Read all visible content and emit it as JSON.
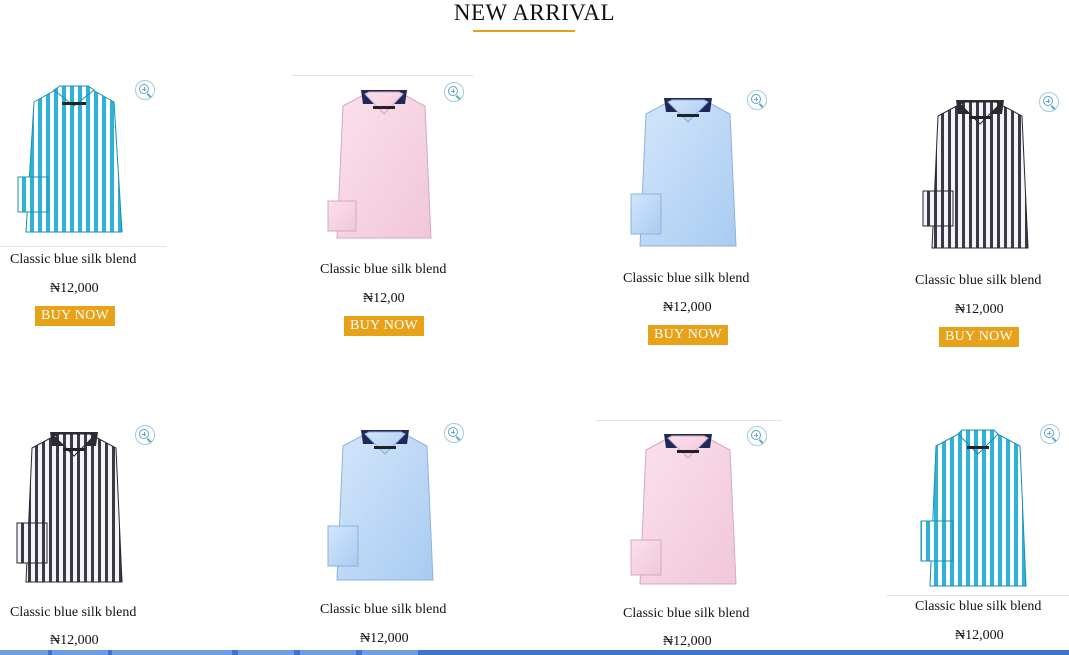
{
  "section": {
    "title": "NEW ARRIVAL",
    "accent_color": "#e8a21a"
  },
  "icons": {
    "zoom": "zoom-in-icon"
  },
  "products": [
    {
      "name": "Classic blue silk blend",
      "price": "₦12,000",
      "button": "BUY NOW",
      "shirt_color": "turquoise-stripe"
    },
    {
      "name": "Classic blue silk blend",
      "price": "₦12,00",
      "button": "BUY NOW",
      "shirt_color": "pink"
    },
    {
      "name": "Classic blue silk blend",
      "price": "₦12,000",
      "button": "BUY NOW",
      "shirt_color": "light-blue"
    },
    {
      "name": "Classic blue silk blend",
      "price": "₦12,000",
      "button": "BUY NOW",
      "shirt_color": "grey-stripe"
    },
    {
      "name": "Classic blue silk blend",
      "price": "₦12,000",
      "shirt_color": "grey-stripe"
    },
    {
      "name": "Classic blue silk blend",
      "price": "₦12,000",
      "shirt_color": "light-blue"
    },
    {
      "name": "Classic blue silk blend",
      "price": "₦12,000",
      "shirt_color": "pink"
    },
    {
      "name": "Classic blue silk blend",
      "price": "₦12,000",
      "shirt_color": "turquoise-stripe"
    }
  ]
}
